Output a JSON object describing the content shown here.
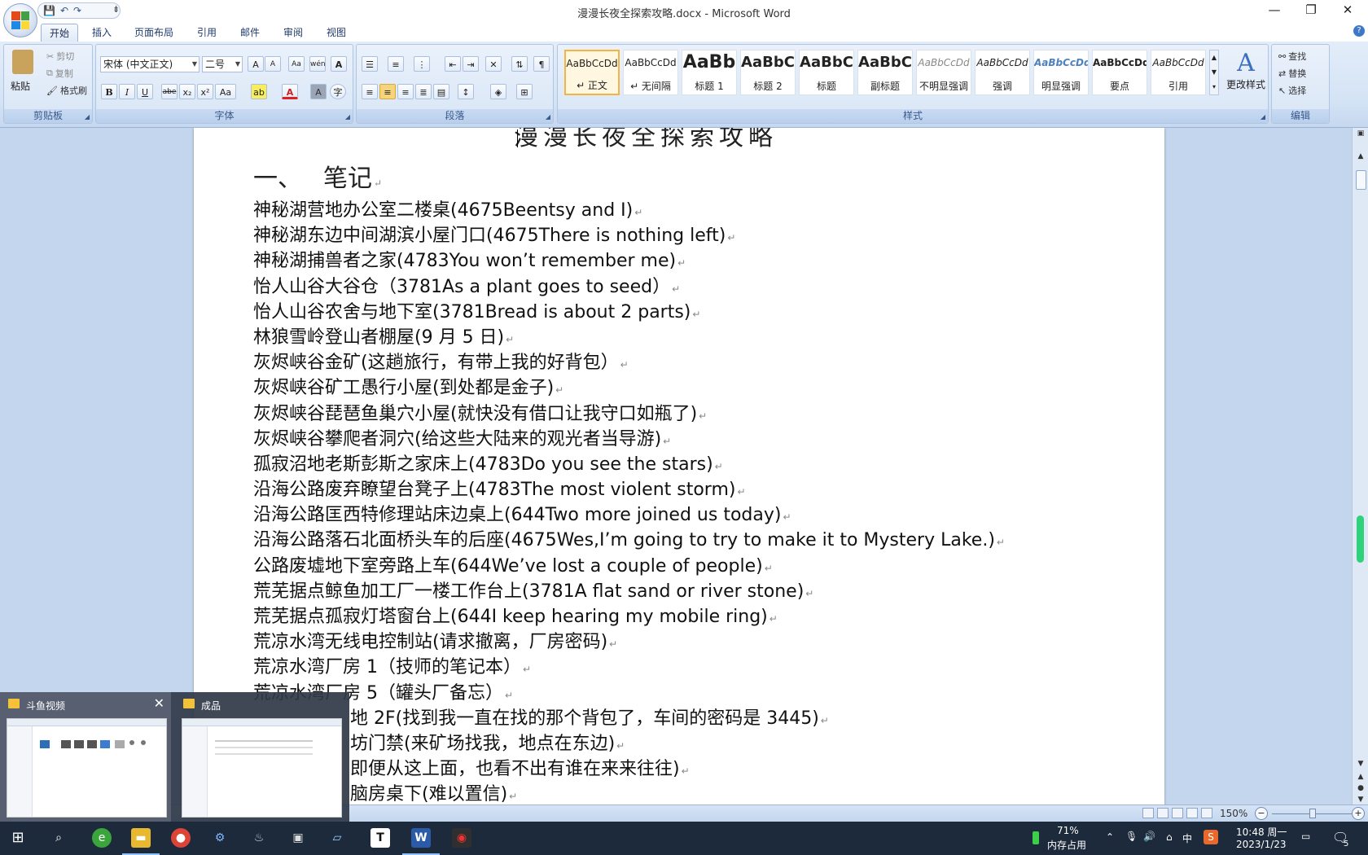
{
  "window": {
    "title": "漫漫长夜全探索攻略.docx - Microsoft Word",
    "minimize": "—",
    "restore": "❐",
    "close": "✕"
  },
  "qat": {
    "save": "💾",
    "undo": "↶",
    "redo": "↷",
    "more": "⇟"
  },
  "tabs": [
    "开始",
    "插入",
    "页面布局",
    "引用",
    "邮件",
    "审阅",
    "视图"
  ],
  "ribbon": {
    "clipboard": {
      "label": "剪贴板",
      "paste": "粘贴",
      "cut": "剪切",
      "copy": "复制",
      "format_painter": "格式刷"
    },
    "font": {
      "label": "字体",
      "font_name": "宋体 (中文正文)",
      "font_size": "二号",
      "bold": "B",
      "italic": "I",
      "underline": "U",
      "strike": "abe",
      "subscript": "x₂",
      "superscript": "x²",
      "change_case": "Aa"
    },
    "paragraph": {
      "label": "段落"
    },
    "styles": {
      "label": "样式",
      "items": [
        {
          "sample": "AaBbCcDd",
          "name": "↵ 正文"
        },
        {
          "sample": "AaBbCcDd",
          "name": "↵ 无间隔"
        },
        {
          "sample": "AaBb",
          "name": "标题 1"
        },
        {
          "sample": "AaBbC",
          "name": "标题 2"
        },
        {
          "sample": "AaBbC",
          "name": "标题"
        },
        {
          "sample": "AaBbC",
          "name": "副标题"
        },
        {
          "sample": "AaBbCcDd",
          "name": "不明显强调"
        },
        {
          "sample": "AaBbCcDd",
          "name": "强调"
        },
        {
          "sample": "AaBbCcDd",
          "name": "明显强调"
        },
        {
          "sample": "AaBbCcDd",
          "name": "要点"
        },
        {
          "sample": "AaBbCcDd",
          "name": "引用"
        }
      ],
      "change_styles": "更改样式"
    },
    "editing": {
      "label": "编辑",
      "find": "查找",
      "replace": "替换",
      "select": "选择"
    }
  },
  "document": {
    "heading_number": "一、",
    "heading_text": "笔记",
    "lines": [
      "神秘湖营地办公室二楼桌(4675Beentsy and I)",
      "神秘湖东边中间湖滨小屋门口(4675There is nothing left)",
      "神秘湖捕兽者之家(4783You won’t remember me)",
      "怡人山谷大谷仓（3781As a plant goes to seed）",
      "怡人山谷农舍与地下室(3781Bread is about 2 parts)",
      "林狼雪岭登山者棚屋(9 月 5 日)",
      "灰烬峡谷金矿(这趟旅行，有带上我的好背包）",
      "灰烬峡谷矿工愚行小屋(到处都是金子)",
      "灰烬峡谷琵琶鱼巢穴小屋(就快没有借口让我守口如瓶了)",
      "灰烬峡谷攀爬者洞穴(给这些大陆来的观光者当导游)",
      "孤寂沼地老斯彭斯之家床上(4783Do you see the stars)",
      "沿海公路废弃瞭望台凳子上(4783The most violent storm)",
      "沿海公路匡西特修理站床边桌上(644Two more joined us today)",
      "沿海公路落石北面桥头车的后座(4675Wes,I’m going to try to make it to Mystery Lake.)",
      "公路废墟地下室旁路上车(644We’ve lost a couple of people)",
      "荒芜据点鲸鱼加工厂一楼工作台上(3781A flat sand or river stone)",
      "荒芜据点孤寂灯塔窗台上(644I keep hearing my mobile ring)",
      "荒凉水湾无线电控制站(请求撤离，厂房密码)",
      "荒凉水湾厂房 1（技师的笔记本）",
      "荒凉水湾厂房 5（罐头厂备忘）",
      "地 2F(找到我一直在找的那个背包了，车间的密码是 3445)",
      "坊门禁(来矿场找我，地点在东边)",
      "即便从这上面，也看不出有谁在来来往往)",
      "脑房桌下(难以置信)"
    ]
  },
  "statusbar": {
    "zoom": "150%"
  },
  "thumbnails": [
    {
      "title": "斗鱼视频",
      "close": "✕"
    },
    {
      "title": "成品"
    }
  ],
  "tray": {
    "memory_pct": "71%",
    "memory_label": "内存占用",
    "ime": "中",
    "time": "10:48 周一",
    "date": "2023/1/23",
    "notif_count": "5"
  }
}
